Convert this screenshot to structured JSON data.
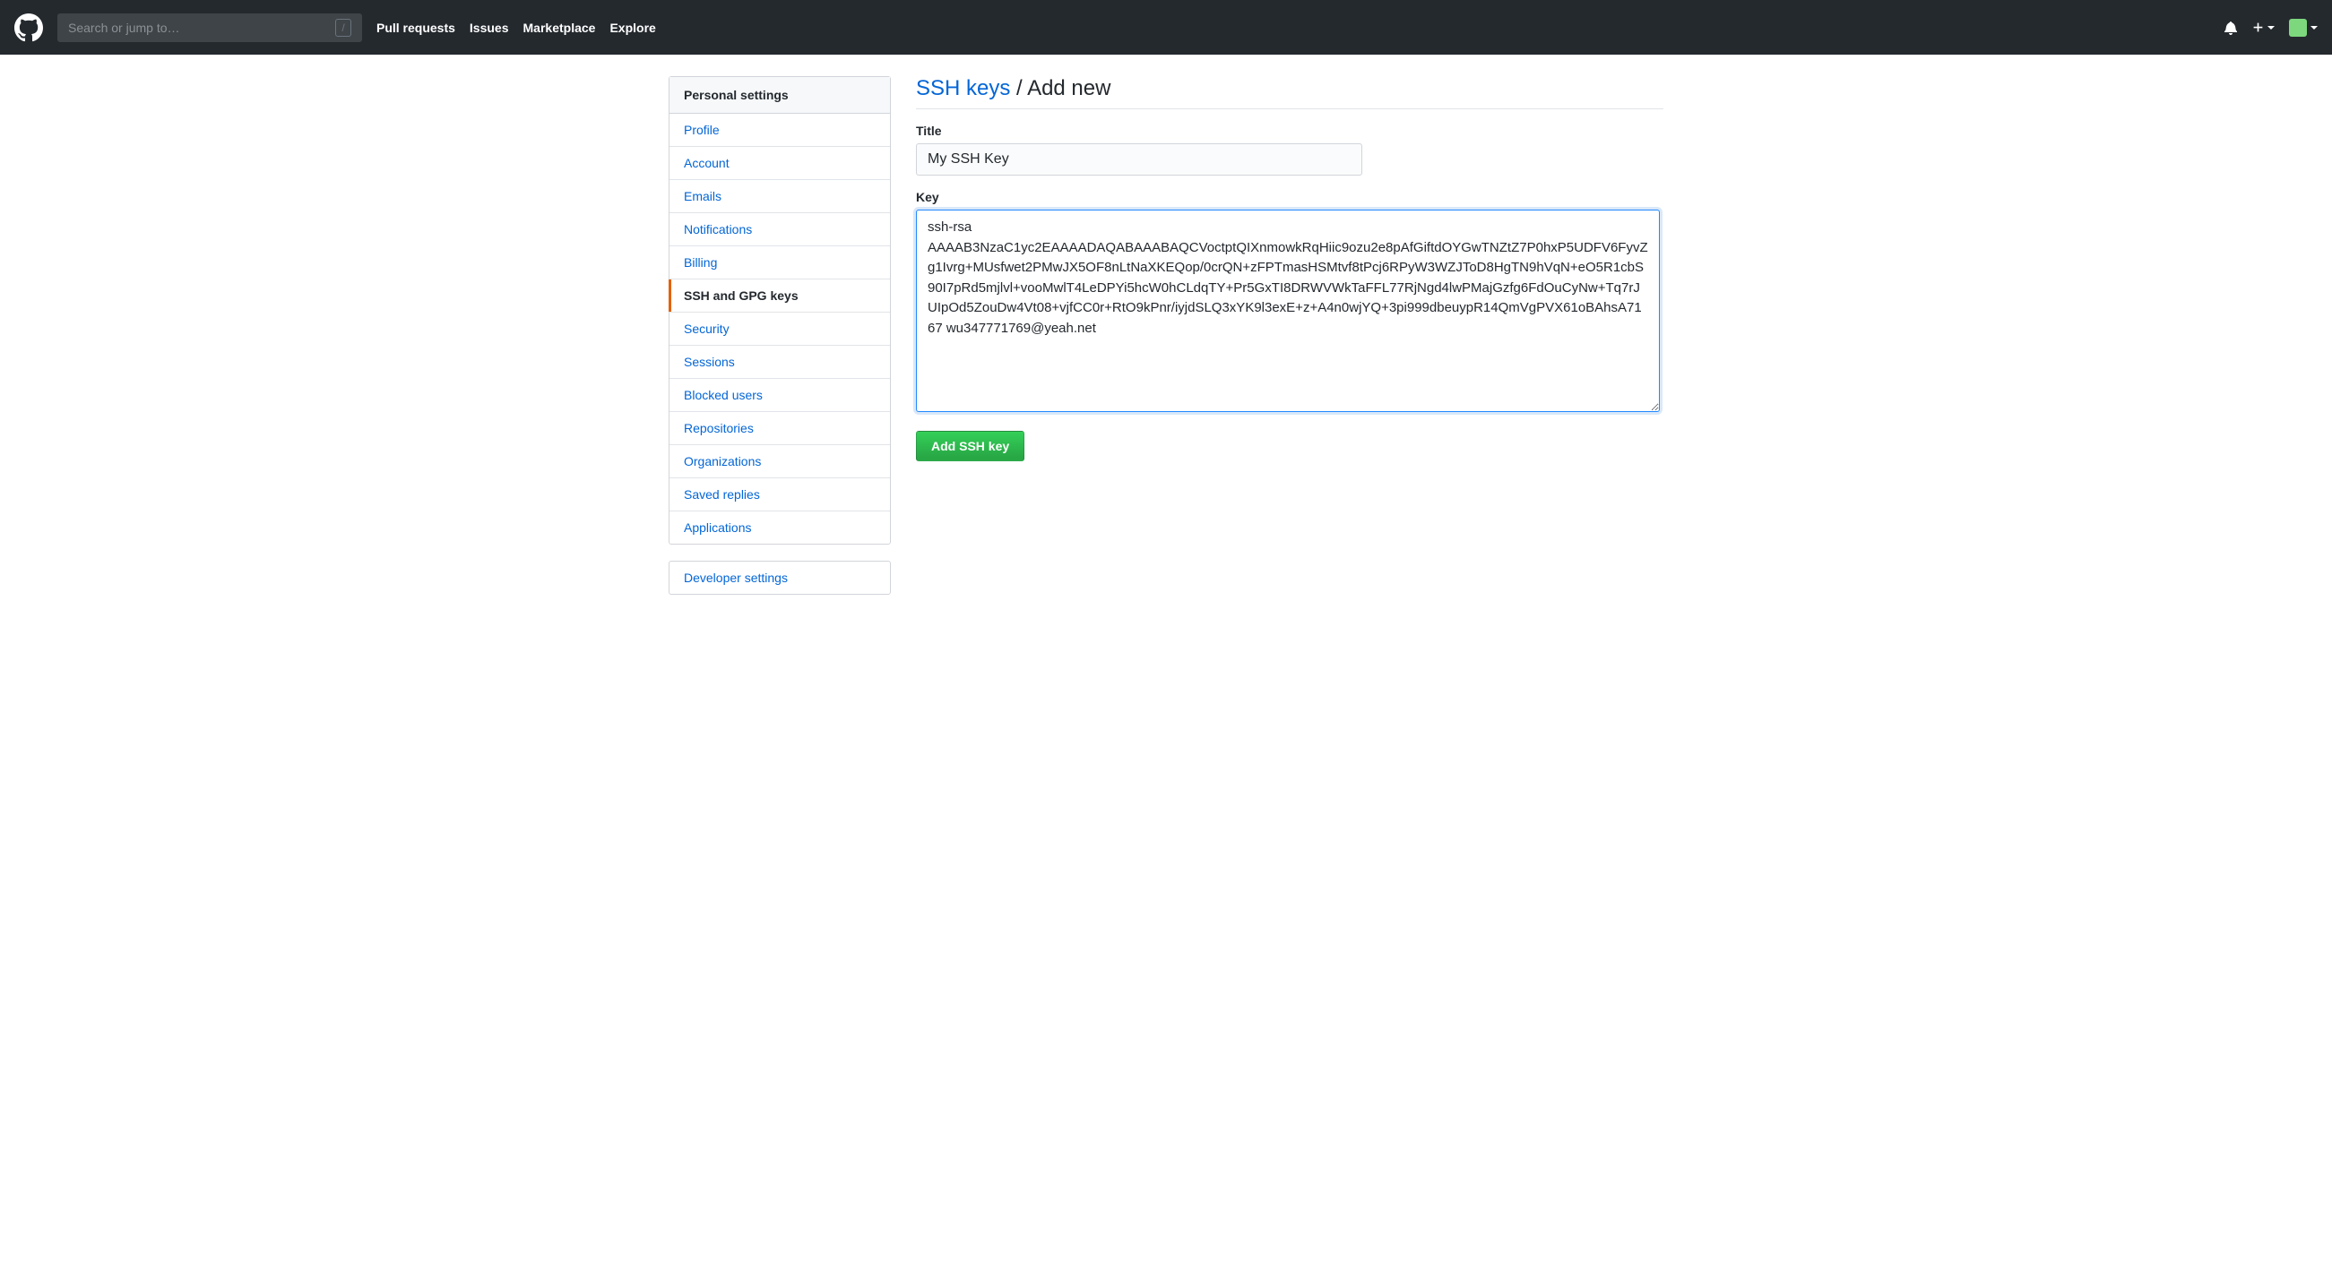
{
  "header": {
    "search_placeholder": "Search or jump to…",
    "nav": {
      "pull_requests": "Pull requests",
      "issues": "Issues",
      "marketplace": "Marketplace",
      "explore": "Explore"
    }
  },
  "sidebar": {
    "header": "Personal settings",
    "items": [
      {
        "label": "Profile",
        "active": false
      },
      {
        "label": "Account",
        "active": false
      },
      {
        "label": "Emails",
        "active": false
      },
      {
        "label": "Notifications",
        "active": false
      },
      {
        "label": "Billing",
        "active": false
      },
      {
        "label": "SSH and GPG keys",
        "active": true
      },
      {
        "label": "Security",
        "active": false
      },
      {
        "label": "Sessions",
        "active": false
      },
      {
        "label": "Blocked users",
        "active": false
      },
      {
        "label": "Repositories",
        "active": false
      },
      {
        "label": "Organizations",
        "active": false
      },
      {
        "label": "Saved replies",
        "active": false
      },
      {
        "label": "Applications",
        "active": false
      }
    ],
    "developer_settings": "Developer settings"
  },
  "page": {
    "title_link": "SSH keys",
    "title_separator": " / ",
    "title_rest": "Add new",
    "title_label": "Title",
    "title_value": "My SSH Key",
    "key_label": "Key",
    "key_value": "ssh-rsa AAAAB3NzaC1yc2EAAAADAQABAAABAQCVoctptQIXnmowkRqHiic9ozu2e8pAfGiftdOYGwTNZtZ7P0hxP5UDFV6FyvZg1Ivrg+MUsfwet2PMwJX5OF8nLtNaXKEQop/0crQN+zFPTmasHSMtvf8tPcj6RPyW3WZJToD8HgTN9hVqN+eO5R1cbS90I7pRd5mjlvl+vooMwlT4LeDPYi5hcW0hCLdqTY+Pr5GxTI8DRWVWkTaFFL77RjNgd4lwPMajGzfg6FdOuCyNw+Tq7rJUIpOd5ZouDw4Vt08+vjfCC0r+RtO9kPnr/iyjdSLQ3xYK9l3exE+z+A4n0wjYQ+3pi999dbeuypR14QmVgPVX61oBAhsA7167 wu347771769@yeah.net",
    "submit_label": "Add SSH key"
  }
}
